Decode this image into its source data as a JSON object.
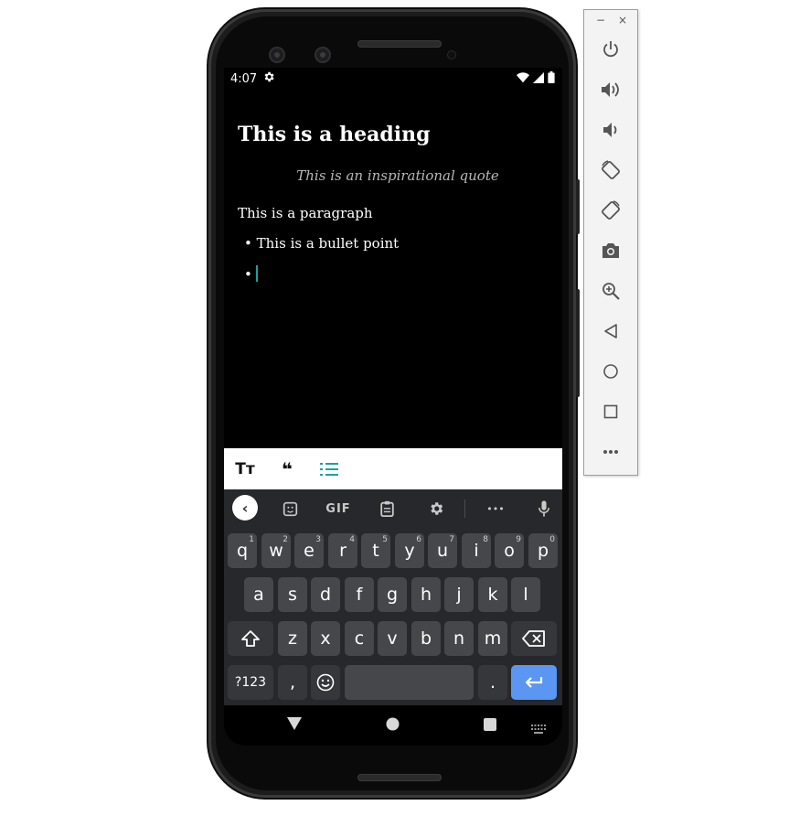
{
  "status_bar": {
    "time": "4:07"
  },
  "editor": {
    "heading": "This is a heading",
    "quote": "This is an inspirational quote",
    "paragraph": "This is a paragraph",
    "bullets": [
      "This is a bullet point",
      ""
    ],
    "bullet_marker": "•",
    "caret_color": "#1ba29b"
  },
  "format_toolbar": {
    "text_size_label": "Tт",
    "quote_label": "❝",
    "list_color": "#1ba29b"
  },
  "keyboard": {
    "gif_label": "GIF",
    "more_label": "•••",
    "row1": [
      {
        "key": "q",
        "sup": "1"
      },
      {
        "key": "w",
        "sup": "2"
      },
      {
        "key": "e",
        "sup": "3"
      },
      {
        "key": "r",
        "sup": "4"
      },
      {
        "key": "t",
        "sup": "5"
      },
      {
        "key": "y",
        "sup": "6"
      },
      {
        "key": "u",
        "sup": "7"
      },
      {
        "key": "i",
        "sup": "8"
      },
      {
        "key": "o",
        "sup": "9"
      },
      {
        "key": "p",
        "sup": "0"
      }
    ],
    "row2": [
      "a",
      "s",
      "d",
      "f",
      "g",
      "h",
      "j",
      "k",
      "l"
    ],
    "row3": [
      "z",
      "x",
      "c",
      "v",
      "b",
      "n",
      "m"
    ],
    "symbols_label": "?123",
    "comma_label": ",",
    "period_label": ".",
    "enter_color": "#5a96f2"
  },
  "emulator_panel": {
    "minimize_label": "−",
    "close_label": "×"
  }
}
